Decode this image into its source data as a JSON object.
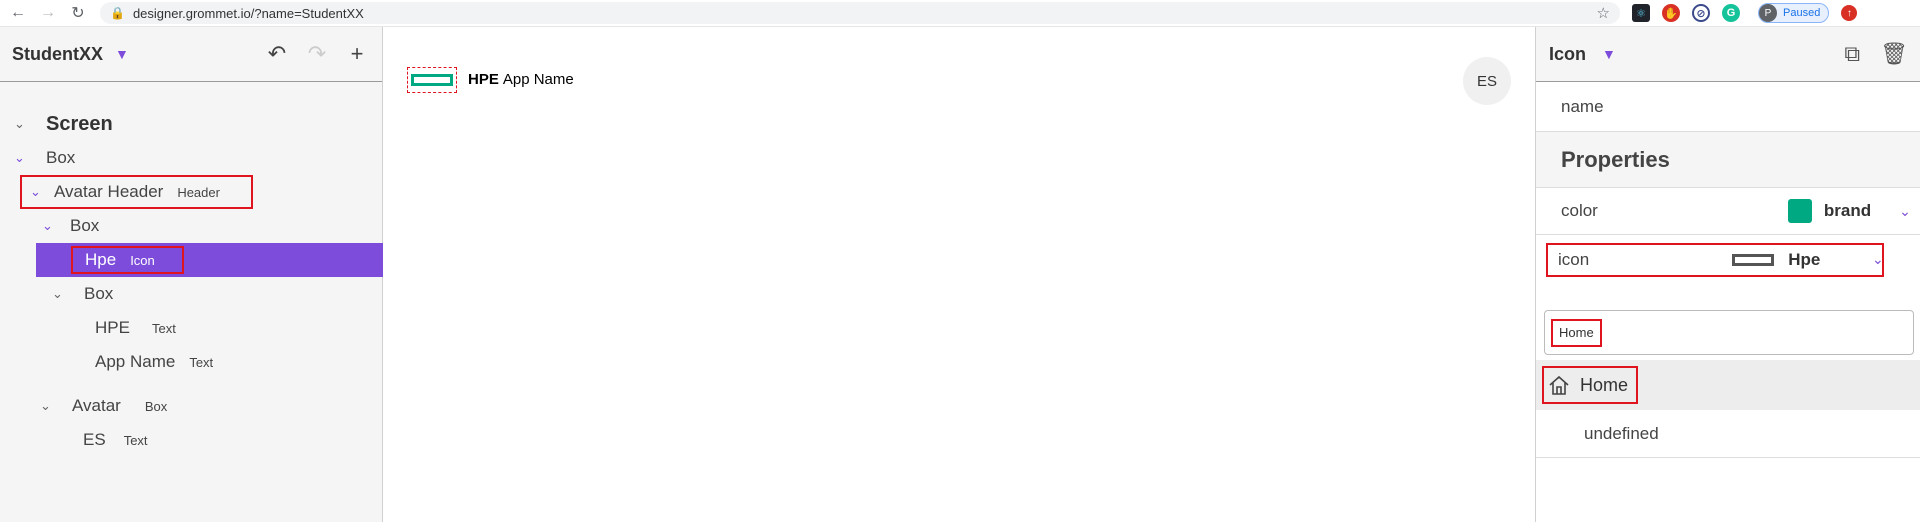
{
  "browser": {
    "url": "designer.grommet.io/?name=StudentXX",
    "profile_label": "Paused",
    "profile_initial": "P"
  },
  "left": {
    "design_name": "StudentXX",
    "tree": [
      {
        "label": "Screen",
        "type": ""
      },
      {
        "label": "Box",
        "type": ""
      },
      {
        "label": "Avatar Header",
        "type": "Header"
      },
      {
        "label": "Box",
        "type": ""
      },
      {
        "label": "Hpe",
        "type": "Icon"
      },
      {
        "label": "Box",
        "type": ""
      },
      {
        "label": "HPE",
        "type": "Text"
      },
      {
        "label": "App Name",
        "type": "Text"
      },
      {
        "label": "Avatar",
        "type": "Box"
      },
      {
        "label": "ES",
        "type": "Text"
      }
    ]
  },
  "canvas": {
    "brand_bold": "HPE",
    "brand_name": "App Name",
    "avatar_initials": "ES"
  },
  "right": {
    "component_type": "Icon",
    "name_label": "name",
    "properties_heading": "Properties",
    "color_label": "color",
    "color_value": "brand",
    "color_hex": "#01a982",
    "icon_label": "icon",
    "icon_value": "Hpe",
    "search_value": "Home",
    "options": [
      "Home",
      "undefined"
    ]
  }
}
